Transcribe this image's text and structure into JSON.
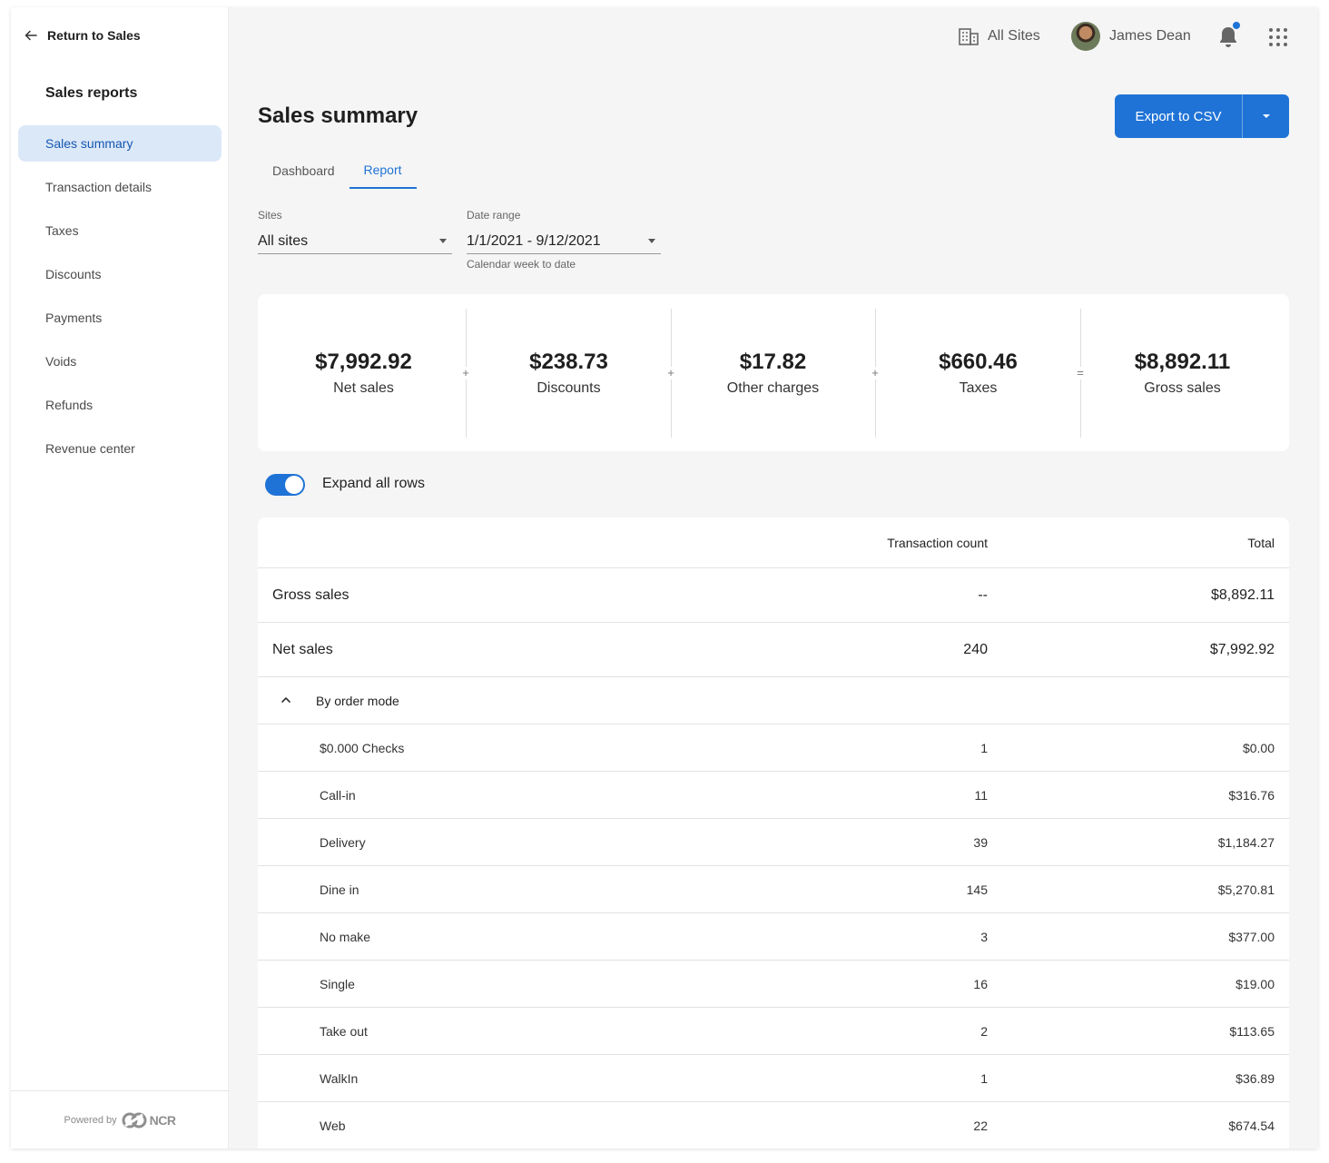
{
  "sidebar": {
    "back_label": "Return to Sales",
    "title": "Sales reports",
    "items": [
      {
        "label": "Sales summary",
        "active": true
      },
      {
        "label": "Transaction details"
      },
      {
        "label": "Taxes"
      },
      {
        "label": "Discounts"
      },
      {
        "label": "Payments"
      },
      {
        "label": "Voids"
      },
      {
        "label": "Refunds"
      },
      {
        "label": "Revenue center"
      }
    ],
    "footer": {
      "powered_by": "Powered by",
      "logo_text": "NCR"
    }
  },
  "topbar": {
    "sites_label": "All Sites",
    "user_name": "James Dean",
    "notification_dot_color": "#1f73d6"
  },
  "header": {
    "title": "Sales summary",
    "export_label": "Export to CSV",
    "tabs": [
      {
        "label": "Dashboard"
      },
      {
        "label": "Report",
        "active": true
      }
    ]
  },
  "filters": {
    "sites": {
      "label": "Sites",
      "value": "All sites"
    },
    "date_range": {
      "label": "Date range",
      "value": "1/1/2021 - 9/12/2021",
      "hint": "Calendar week to date"
    }
  },
  "summary": [
    {
      "value": "$7,992.92",
      "label": "Net sales",
      "op": "+"
    },
    {
      "value": "$238.73",
      "label": "Discounts",
      "op": "+"
    },
    {
      "value": "$17.82",
      "label": "Other charges",
      "op": "+"
    },
    {
      "value": "$660.46",
      "label": "Taxes",
      "op": "="
    },
    {
      "value": "$8,892.11",
      "label": "Gross sales"
    }
  ],
  "toggle": {
    "label": "Expand all rows",
    "on": true
  },
  "table": {
    "headers": [
      "",
      "Transaction count",
      "Total"
    ],
    "top_rows": [
      {
        "name": "Gross sales",
        "count": "--",
        "total": "$8,892.11"
      },
      {
        "name": "Net sales",
        "count": "240",
        "total": "$7,992.92"
      }
    ],
    "group_label": "By order mode",
    "sub_rows": [
      {
        "name": "$0.000 Checks",
        "count": "1",
        "total": "$0.00"
      },
      {
        "name": "Call-in",
        "count": "11",
        "total": "$316.76"
      },
      {
        "name": "Delivery",
        "count": "39",
        "total": "$1,184.27"
      },
      {
        "name": "Dine in",
        "count": "145",
        "total": "$5,270.81"
      },
      {
        "name": "No make",
        "count": "3",
        "total": "$377.00"
      },
      {
        "name": "Single",
        "count": "16",
        "total": "$19.00"
      },
      {
        "name": "Take out",
        "count": "2",
        "total": "$113.65"
      },
      {
        "name": "WalkIn",
        "count": "1",
        "total": "$36.89"
      },
      {
        "name": "Web",
        "count": "22",
        "total": "$674.54"
      }
    ]
  },
  "colors": {
    "accent": "#1f73d6",
    "active_nav_bg": "#dbe8f8"
  }
}
